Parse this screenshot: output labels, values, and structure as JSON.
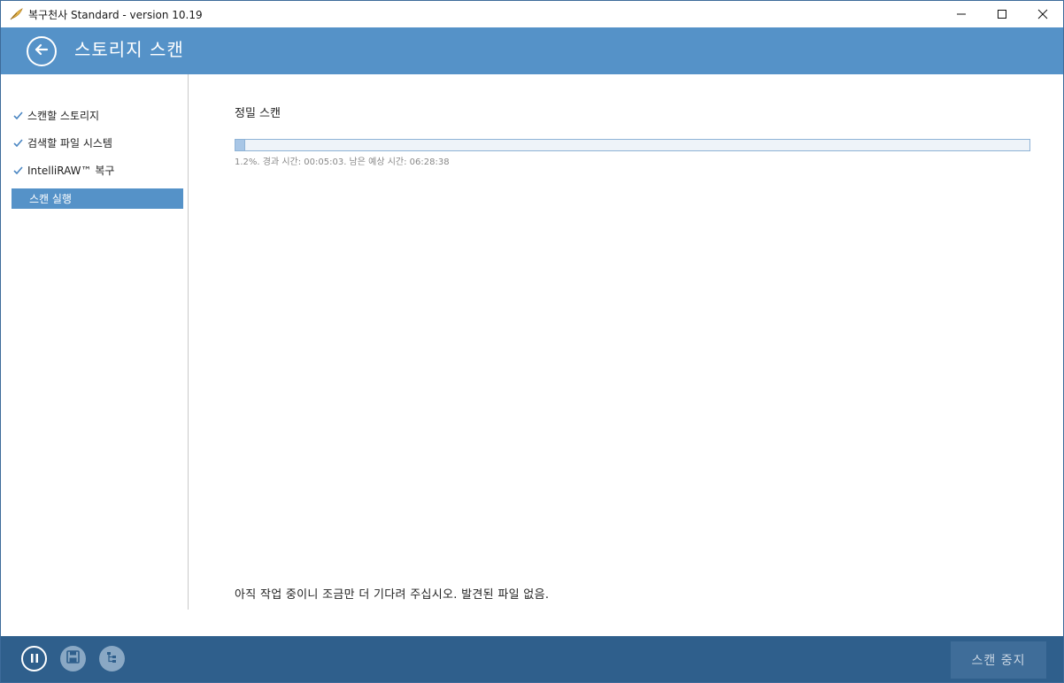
{
  "window": {
    "title": "복구천사 Standard - version 10.19",
    "icons": {
      "app": "feather-icon",
      "minimize": "minimize-icon",
      "maximize": "maximize-icon",
      "close": "close-icon"
    }
  },
  "header": {
    "title": "스토리지 스캔",
    "back_icon": "arrow-left-icon"
  },
  "sidebar": {
    "steps": [
      {
        "label": "스캔할 스토리지",
        "done": true
      },
      {
        "label": "검색할 파일 시스템",
        "done": true
      },
      {
        "label": "IntelliRAW™ 복구",
        "done": true
      },
      {
        "label": "스캔 실행",
        "done": false,
        "active": true
      }
    ]
  },
  "main": {
    "title": "정밀 스캔",
    "progress": {
      "percent": 1.2,
      "info": "1.2%. 경과 시간: 00:05:03. 남은 예상 시간: 06:28:38"
    },
    "status": "아직 작업 중이니 조금만 더 기다려 주십시오. 발견된 파일 없음."
  },
  "footer": {
    "icons": {
      "pause": "pause-icon",
      "save": "save-icon",
      "tree": "tree-view-icon"
    },
    "stop_label": "스캔 중지"
  },
  "colors": {
    "accent": "#5592c8",
    "footer": "#2f5f8c",
    "progress_fill": "#a8c6e6",
    "progress_border": "#8fb3d6"
  }
}
